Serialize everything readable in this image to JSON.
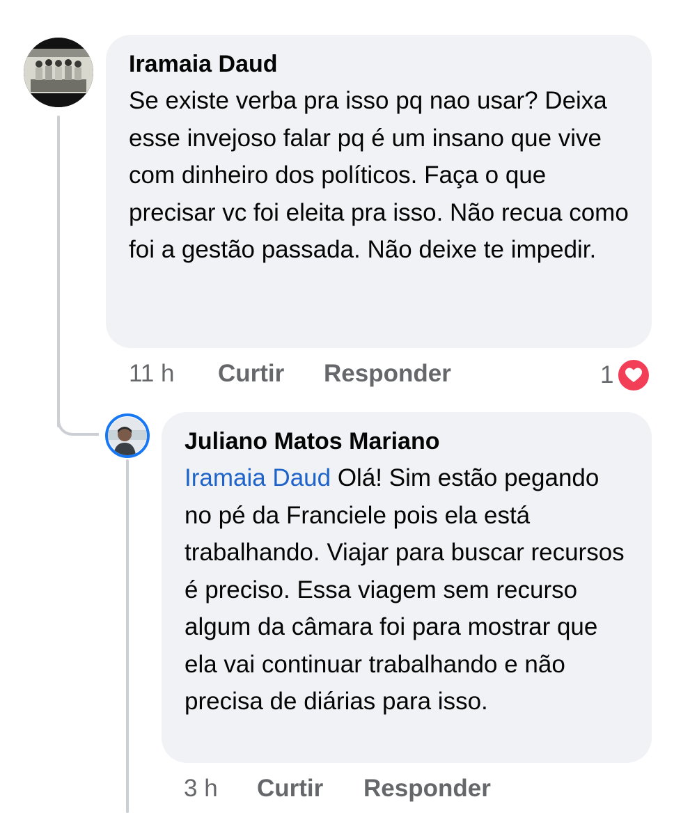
{
  "comments": [
    {
      "author": "Iramaia Daud",
      "text": "Se existe verba pra isso pq nao usar? Deixa esse invejoso falar pq é um insano que vive com dinheiro dos políticos. Faça o que precisar vc foi eleita pra isso. Não recua como foi a gestão passada.  Não deixe te impedir.",
      "time": "11 h",
      "like_label": "Curtir",
      "reply_label": "Responder",
      "reaction_count": "1",
      "reaction_icon": "heart-icon"
    },
    {
      "author": "Juliano Matos Mariano",
      "mention": "Iramaia Daud",
      "text": " Olá! Sim estão pegando no pé da Franciele pois ela está trabalhando. Viajar para buscar recursos é preciso. Essa viagem sem recurso algum da câmara foi para mostrar que ela vai continuar trabalhando e não precisa de diárias para isso.",
      "time": "3 h",
      "like_label": "Curtir",
      "reply_label": "Responder"
    }
  ],
  "colors": {
    "bubble": "#f0f2f5",
    "mention": "#1d63c9",
    "meta_text": "#65676b",
    "reaction_heart": "#f33e58",
    "avatar_ring": "#1877f2"
  }
}
